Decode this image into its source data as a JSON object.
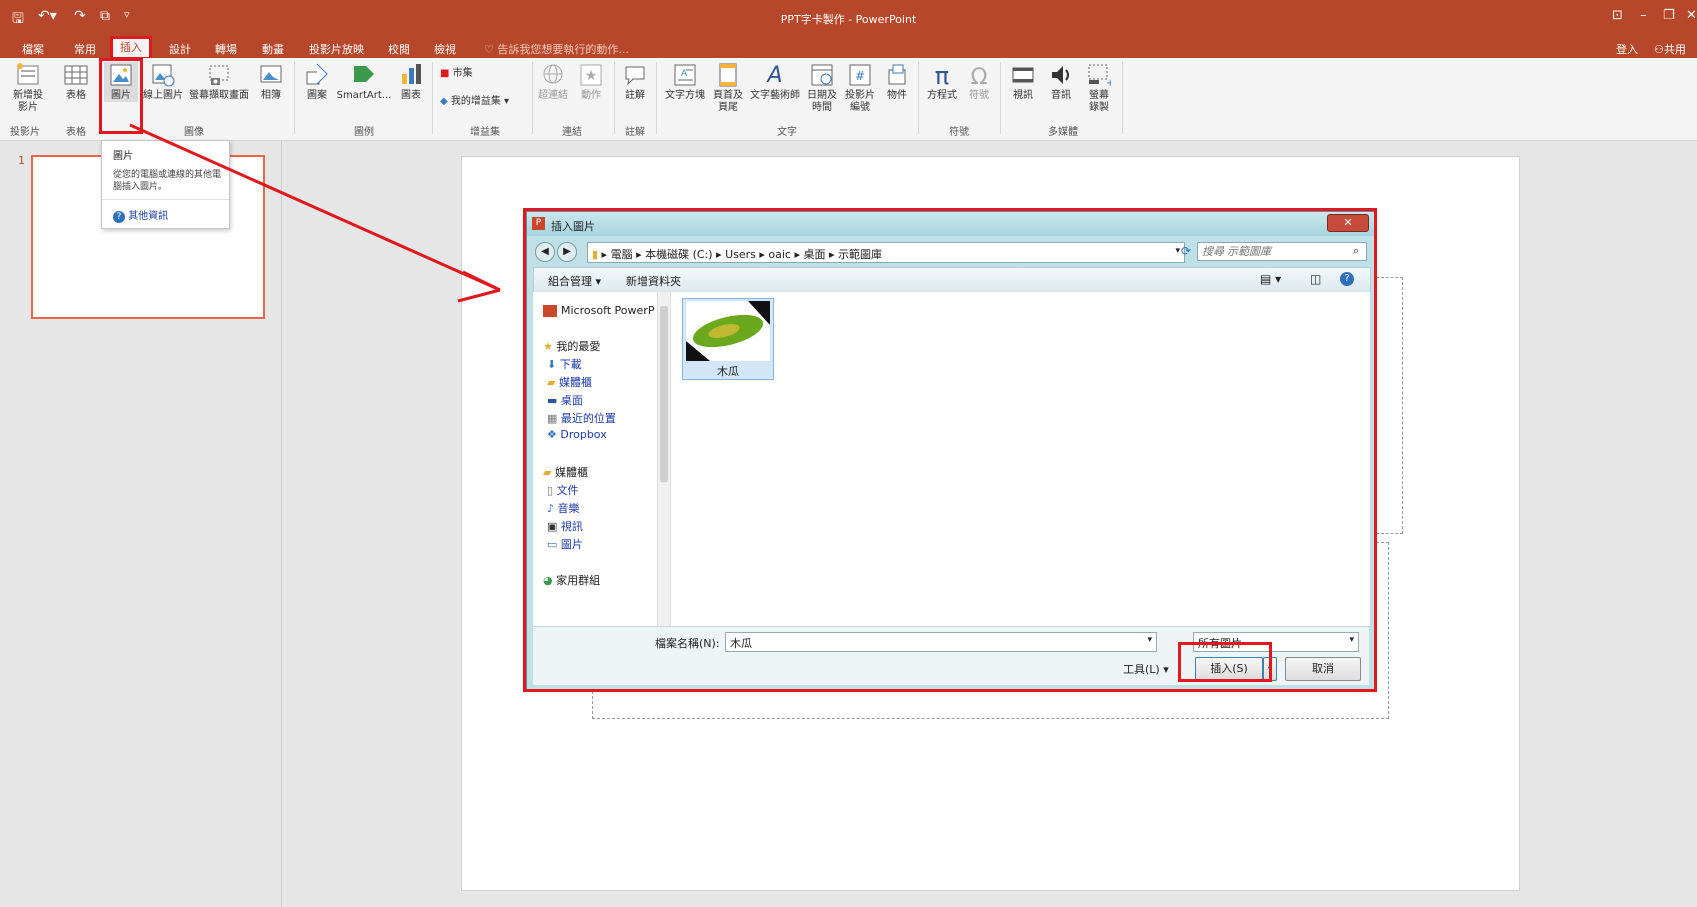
{
  "window": {
    "title": "PPT字卡製作 - PowerPoint",
    "sign_in": "登入",
    "share": "共用"
  },
  "tabs": [
    "檔案",
    "常用",
    "插入",
    "設計",
    "轉場",
    "動畫",
    "投影片放映",
    "校閱",
    "檢視"
  ],
  "tell_me": "告訴我您想要執行的動作...",
  "ribbon": {
    "buttons": {
      "new_slide": "新增投影片",
      "table": "表格",
      "picture": "圖片",
      "online_picture": "線上圖片",
      "screenshot": "螢幕擷取畫面",
      "album": "相簿",
      "shapes": "圖案",
      "smartart": "SmartArt...",
      "chart": "圖表",
      "store": "市集",
      "my_addins": "我的增益集",
      "hyperlink": "超連結",
      "action": "動作",
      "comment": "註解",
      "textbox": "文字方塊",
      "header_footer": "頁首及頁尾",
      "wordart": "文字藝術師",
      "datetime": "日期及時間",
      "slide_number": "投影片編號",
      "object": "物件",
      "equation": "方程式",
      "symbol": "符號",
      "video": "視訊",
      "audio": "音訊",
      "screen_recording": "螢幕錄製"
    },
    "groups": [
      "投影片",
      "表格",
      "圖像",
      "圖例",
      "增益集",
      "連結",
      "註解",
      "文字",
      "符號",
      "多媒體"
    ]
  },
  "tooltip": {
    "title": "圖片",
    "desc": "從您的電腦或連線的其他電腦插入圖片。",
    "more": "其他資訊"
  },
  "slide_number": "1",
  "dialog": {
    "title": "插入圖片",
    "path": [
      "電腦",
      "本機磁碟 (C:)",
      "Users",
      "oaic",
      "桌面",
      "示範圖庫"
    ],
    "search_placeholder": "搜尋 示範圖庫",
    "organize": "組合管理 ▾",
    "new_folder": "新增資料夾",
    "nav": [
      "Microsoft PowerP",
      "我的最愛",
      "下載",
      "媒體櫃",
      "桌面",
      "最近的位置",
      "Dropbox",
      "媒體櫃",
      "文件",
      "音樂",
      "視訊",
      "圖片",
      "家用群組"
    ],
    "file_name": "木瓜",
    "filename_label": "檔案名稱(N):",
    "filename_value": "木瓜",
    "filter": "所有圖片",
    "tools": "工具(L)",
    "insert": "插入(S)",
    "cancel": "取消"
  },
  "colors": {
    "accent": "#b7472a",
    "highlight": "#e0191e"
  }
}
